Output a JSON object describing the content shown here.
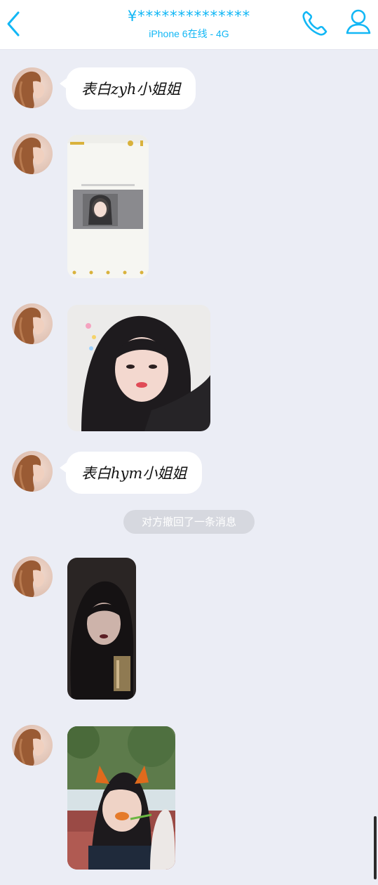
{
  "header": {
    "title": "¥**************",
    "subtitle": "iPhone 6在线 - 4G",
    "back_icon": "chevron-left-icon",
    "call_icon": "phone-icon",
    "profile_icon": "person-icon"
  },
  "colors": {
    "accent": "#12b7f5",
    "background": "#ebedf5",
    "bubble": "#ffffff",
    "notice_bg": "#d6d8df"
  },
  "messages": [
    {
      "type": "text",
      "text": "表白zyh小姐姐"
    },
    {
      "type": "image",
      "description_icon": "screenshot-image"
    },
    {
      "type": "image",
      "description_icon": "selfie-image"
    },
    {
      "type": "text",
      "text": "表白hym小姐姐"
    },
    {
      "type": "system",
      "text": "对方撤回了一条消息"
    },
    {
      "type": "image",
      "description_icon": "selfie-image"
    },
    {
      "type": "image",
      "description_icon": "selfie-image"
    }
  ]
}
